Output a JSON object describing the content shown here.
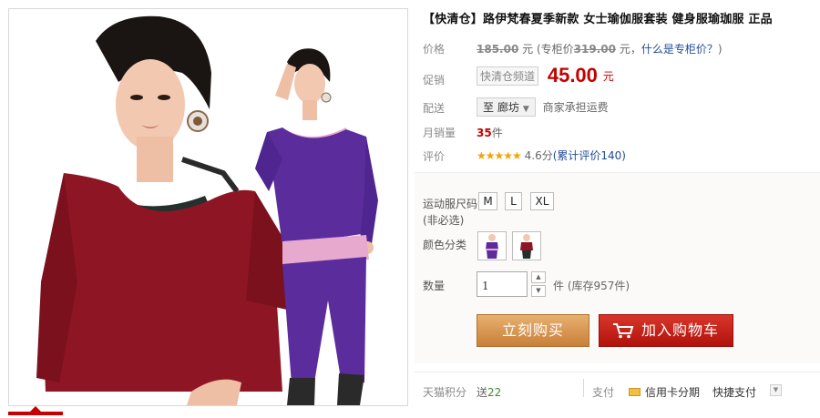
{
  "product": {
    "title": "【快清仓】路伊梵春夏季新款 女士瑜伽服套装 健身服瑜珈服 正品"
  },
  "price": {
    "label": "价格",
    "original": "185.00",
    "unit": "元",
    "counter_prefix": "(专柜价",
    "counter_price": "319.00",
    "counter_suffix": "元，",
    "counter_link": "什么是专柜价？",
    "close_paren": ")"
  },
  "promo": {
    "label": "促销",
    "channel": "快清仓频道",
    "price": "45.00",
    "unit": "元"
  },
  "shipping": {
    "label": "配送",
    "destination": "至 廊坊",
    "note": "商家承担运费"
  },
  "sales": {
    "label": "月销量",
    "count": "35",
    "unit": "件"
  },
  "rating": {
    "label": "评价",
    "stars": "★★★★★",
    "score": "4.6分",
    "reviews_link": "(累计评价140)"
  },
  "options": {
    "size_label_line1": "运动服尺码",
    "size_label_line2": "(非必选)",
    "sizes": [
      "M",
      "L",
      "XL"
    ],
    "color_label": "颜色分类",
    "color_icons": [
      "purple-outfit-swatch",
      "red-outfit-swatch"
    ],
    "quantity_label": "数量",
    "quantity_value": "1",
    "quantity_unit": "件",
    "stock_text": "(库存957件)"
  },
  "actions": {
    "buy_now": "立刻购买",
    "add_to_cart": "加入购物车"
  },
  "footer": {
    "points_label": "天猫积分",
    "points_prefix": "送",
    "points_value": "22",
    "pay_label": "支付",
    "installment": "信用卡分期",
    "quick_pay": "快捷支付"
  },
  "colors": {
    "accent_red": "#c40000",
    "buy_orange": "#d8954e",
    "cart_red": "#c0201a",
    "link_blue": "#1f4c9a"
  }
}
